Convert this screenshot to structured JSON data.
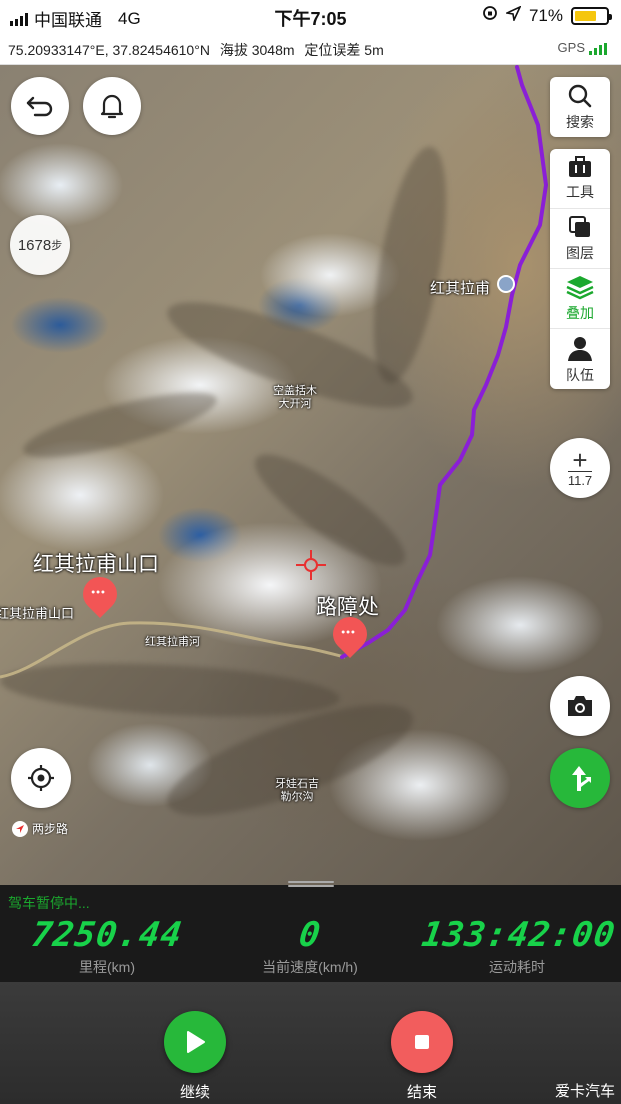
{
  "status_bar": {
    "carrier": "中国联通",
    "network": "4G",
    "time": "下午7:05",
    "battery_percent": "71%",
    "battery_level": 0.71
  },
  "coord_bar": {
    "coordinates": "75.20933147°E, 37.82454610°N",
    "altitude": "海拔 3048m",
    "accuracy": "定位误差 5m",
    "gps_label": "GPS"
  },
  "map": {
    "step_count": "1678",
    "step_unit": "步",
    "labels": {
      "poi_hongqilafu": "红其拉甫",
      "poi_pass": "红其拉甫山口",
      "poi_pass_edge": "红其拉甫山口",
      "roadblock": "路障处",
      "river": "红其拉甫河",
      "valley_top_line1": "空盖括木",
      "valley_top_line2": "大开河",
      "valley_bottom_line1": "牙娃石吉",
      "valley_bottom_line2": "勒尔沟"
    },
    "zoom_level": "11.7",
    "brand": "两步路"
  },
  "tools": [
    {
      "key": "search",
      "label": "搜索",
      "icon": "search-icon"
    },
    {
      "key": "tools",
      "label": "工具",
      "icon": "toolbox-icon"
    },
    {
      "key": "layers",
      "label": "图层",
      "icon": "layers-icon"
    },
    {
      "key": "overlay",
      "label": "叠加",
      "icon": "overlay-stack-icon",
      "active": true
    },
    {
      "key": "team",
      "label": "队伍",
      "icon": "team-user-icon"
    }
  ],
  "stats": {
    "status": "驾车暂停中...",
    "distance_value": "7250.44",
    "distance_label": "里程(km)",
    "speed_value": "0",
    "speed_label": "当前速度(km/h)",
    "time_value": "133:42:00",
    "time_label": "运动耗时"
  },
  "controls": {
    "continue_label": "继续",
    "end_label": "结束"
  },
  "watermark": "爱卡汽车",
  "colors": {
    "accent_green": "#1ba82e",
    "stat_green": "#18d24a",
    "route_purple": "#8a1fd6",
    "pin_red": "#f25555",
    "stop_red": "#f25d5d"
  }
}
